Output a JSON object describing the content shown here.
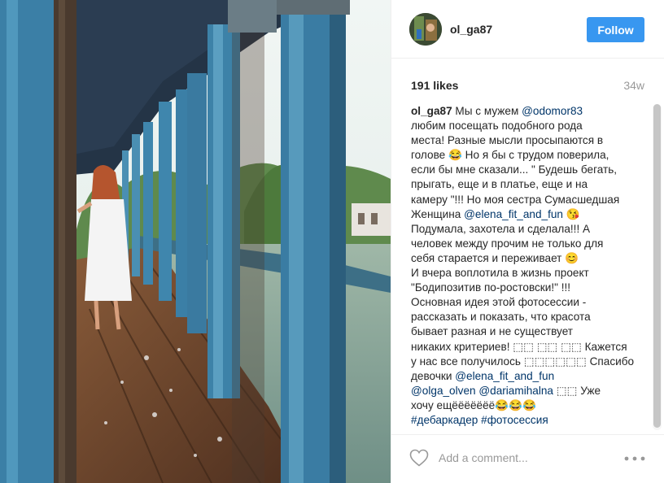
{
  "post": {
    "username": "ol_ga87",
    "follow_label": "Follow",
    "likes": "191 likes",
    "age": "34w",
    "caption_lines": [
      [
        {
          "t": "ol_ga87",
          "k": "user"
        },
        {
          "t": " Мы с мужем "
        },
        {
          "t": "@odomor83",
          "k": "link"
        }
      ],
      [
        {
          "t": "любим посещать подобного рода"
        }
      ],
      [
        {
          "t": "места! Разные мысли просыпаются в"
        }
      ],
      [
        {
          "t": "голове 😂 Но я бы с трудом поверила,"
        }
      ],
      [
        {
          "t": "если бы мне сказали... \" Будешь бегать,"
        }
      ],
      [
        {
          "t": "прыгать, еще и в платье, еще и на"
        }
      ],
      [
        {
          "t": "камеру \"!!! Но моя сестра Сумасшедшая"
        }
      ],
      [
        {
          "t": "Женщина "
        },
        {
          "t": "@elena_fit_and_fun",
          "k": "link"
        },
        {
          "t": " 😘"
        }
      ],
      [
        {
          "t": "Подумала, захотела и сделала!!! А"
        }
      ],
      [
        {
          "t": "человек между прочим не только для"
        }
      ],
      [
        {
          "t": "себя старается и переживает 😊"
        }
      ],
      [
        {
          "t": "И вчера воплотила в жизнь проект"
        }
      ],
      [
        {
          "t": "\"Бодипозитив по-ростовски!\" !!!"
        }
      ],
      [
        {
          "t": "Основная идея этой фотосессии -"
        }
      ],
      [
        {
          "t": "рассказать и показать, что красота"
        }
      ],
      [
        {
          "t": "бывает разная и не существует"
        }
      ],
      [
        {
          "t": "никаких критериев! ⬚⬚ ⬚⬚ ⬚⬚ Кажется"
        }
      ],
      [
        {
          "t": "у нас все получилось ⬚⬚⬚⬚⬚⬚ Спасибо"
        }
      ],
      [
        {
          "t": "девочки "
        },
        {
          "t": "@elena_fit_and_fun",
          "k": "link"
        }
      ],
      [
        {
          "t": "@olga_olven",
          "k": "link"
        },
        {
          "t": " "
        },
        {
          "t": "@dariamihalna",
          "k": "link"
        },
        {
          "t": " ⬚⬚ Уже"
        }
      ],
      [
        {
          "t": "хочу ещёёёёёёё😂😂😂"
        }
      ],
      [
        {
          "t": "#дебаркадер",
          "k": "link"
        },
        {
          "t": " "
        },
        {
          "t": "#фотосессия",
          "k": "link"
        }
      ]
    ],
    "comment_placeholder": "Add a comment...",
    "more_label": "•••"
  },
  "colors": {
    "follow_bg": "#3897f0",
    "link": "#003569",
    "muted": "#999999"
  },
  "icons": [
    "heart-icon",
    "more-options-icon"
  ]
}
